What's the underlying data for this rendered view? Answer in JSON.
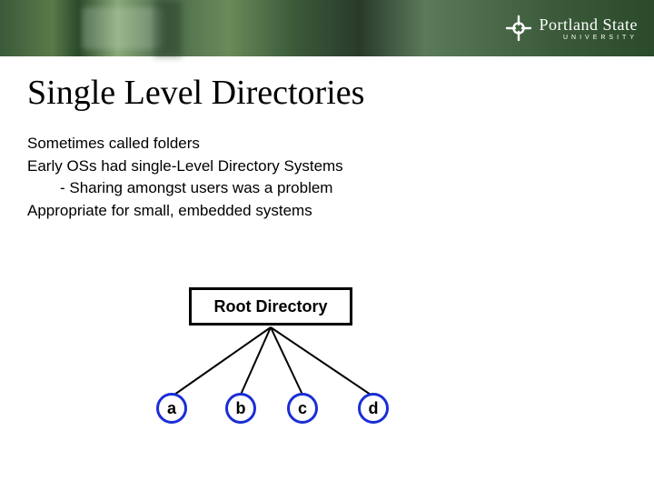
{
  "brand": {
    "name": "Portland State",
    "subname": "UNIVERSITY"
  },
  "slide": {
    "title": "Single Level Directories",
    "lines": {
      "l1": "Sometimes called folders",
      "l2": "Early OSs had single-Level Directory Systems",
      "l3_bullet": "-  Sharing amongst users was a problem",
      "l4": "Appropriate for small, embedded systems"
    }
  },
  "diagram": {
    "root_label": "Root Directory",
    "nodes": {
      "a": "a",
      "b": "b",
      "c": "c",
      "d": "d"
    }
  }
}
